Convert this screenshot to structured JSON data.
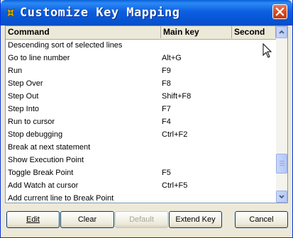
{
  "window": {
    "title": "Customize Key Mapping"
  },
  "columns": [
    "Command",
    "Main key",
    "Second"
  ],
  "rows": [
    {
      "command": "Descending sort of selected lines",
      "key": ""
    },
    {
      "command": "Go to line number",
      "key": "Alt+G"
    },
    {
      "command": "Run",
      "key": "F9"
    },
    {
      "command": "Step Over",
      "key": "F8"
    },
    {
      "command": "Step Out",
      "key": "Shift+F8"
    },
    {
      "command": "Step Into",
      "key": "F7"
    },
    {
      "command": "Run to cursor",
      "key": "F4"
    },
    {
      "command": "Stop debugging",
      "key": "Ctrl+F2"
    },
    {
      "command": "Break at next statement",
      "key": ""
    },
    {
      "command": "Show Execution Point",
      "key": ""
    },
    {
      "command": "Toggle Break Point",
      "key": "F5"
    },
    {
      "command": "Add Watch at cursor",
      "key": "Ctrl+F5"
    },
    {
      "command": "Add current line to Break Point",
      "key": ""
    }
  ],
  "buttons": {
    "edit": "Edit",
    "clear": "Clear",
    "default": "Default",
    "extend_key": "Extend Key",
    "cancel": "Cancel"
  }
}
